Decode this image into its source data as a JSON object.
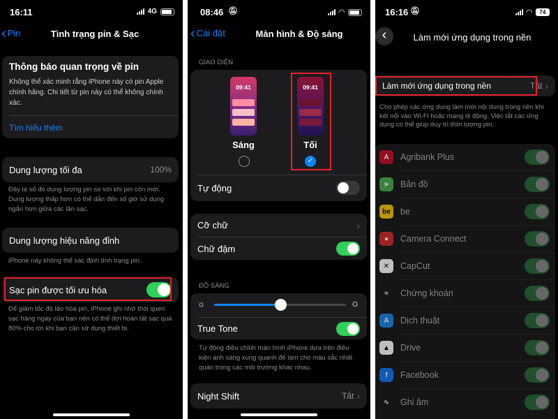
{
  "panel1": {
    "status": {
      "time": "16:11",
      "network": "4G"
    },
    "back_label": "Pin",
    "title": "Tình trạng pin & Sạc",
    "notice": {
      "title": "Thông báo quan trọng về pin",
      "body": "Không thể xác minh rằng iPhone này có pin Apple chính hãng. Chi tiết từ pin này có thể không chính xác.",
      "link": "Tìm hiểu thêm"
    },
    "max_capacity": {
      "label": "Dung lượng tối đa",
      "value": "100%"
    },
    "max_capacity_note": "Đây là số đo dung lượng pin so với khi pin còn mới. Dung lượng thấp hơn có thể dẫn đến số giờ sử dụng ngắn hơn giữa các lần sạc.",
    "peak": {
      "label": "Dung lượng hiệu năng đỉnh"
    },
    "peak_note": "iPhone này không thể xác định tình trạng pin.",
    "optimized": {
      "label": "Sạc pin được tối ưu hóa",
      "enabled": true
    },
    "optimized_note": "Để giảm tốc độ lão hóa pin, iPhone ghi nhớ thói quen sạc hàng ngày của bạn nên có thể đợi hoàn tất sạc quá 80% cho tới khi bạn cần sử dụng thiết bị."
  },
  "panel2": {
    "status": {
      "time": "08:46"
    },
    "back_label": "Cài đặt",
    "title": "Màn hình & Độ sáng",
    "appearance_header": "GIAO DIỆN",
    "light": {
      "label": "Sáng",
      "preview_time": "09:41",
      "selected": false
    },
    "dark": {
      "label": "Tối",
      "preview_time": "09:41",
      "selected": true,
      "check": "✓"
    },
    "automatic": {
      "label": "Tự động",
      "enabled": false
    },
    "text_size": {
      "label": "Cỡ chữ"
    },
    "bold_text": {
      "label": "Chữ đậm",
      "enabled": true
    },
    "brightness_header": "ĐỘ SÁNG",
    "brightness_level": 0.5,
    "true_tone": {
      "label": "True Tone",
      "enabled": true
    },
    "true_tone_note": "Tự động điều chỉnh màn hình iPhone dựa trên điều kiện ánh sáng xung quanh để làm cho màu sắc nhất quán trong các môi trường khác nhau.",
    "night_shift": {
      "label": "Night Shift",
      "value": "Tắt"
    }
  },
  "panel3": {
    "status": {
      "time": "16:16",
      "battery": "74"
    },
    "title": "Làm mới ứng dụng trong nền",
    "bg_refresh": {
      "label": "Làm mới ứng dụng trong nền",
      "value": "Tắt"
    },
    "note": "Cho phép các ứng dụng làm mới nội dung trong nền khi kết nối vào Wi-Fi hoặc mạng di động. Việc tắt các ứng dụng có thể giúp duy trì thời lượng pin.",
    "apps": [
      {
        "name": "Agribank Plus",
        "icon": "agribank-icon",
        "color": "#c8102e",
        "glyph": "A"
      },
      {
        "name": "Bản đồ",
        "icon": "maps-icon",
        "color": "#4caf50",
        "glyph": "➤"
      },
      {
        "name": "be",
        "icon": "be-icon",
        "color": "#f6c800",
        "glyph": "be"
      },
      {
        "name": "Camera Connect",
        "icon": "camera-connect-icon",
        "color": "#d32f2f",
        "glyph": "●"
      },
      {
        "name": "CapCut",
        "icon": "capcut-icon",
        "color": "#ffffff",
        "glyph": "✕"
      },
      {
        "name": "Chứng khoán",
        "icon": "stocks-icon",
        "color": "#1c1c1e",
        "glyph": "≈"
      },
      {
        "name": "Dịch thuật",
        "icon": "translate-icon",
        "color": "#1e88e5",
        "glyph": "A"
      },
      {
        "name": "Drive",
        "icon": "drive-icon",
        "color": "#ffffff",
        "glyph": "▲"
      },
      {
        "name": "Facebook",
        "icon": "facebook-icon",
        "color": "#1877f2",
        "glyph": "f"
      },
      {
        "name": "Ghi âm",
        "icon": "voice-memos-icon",
        "color": "#1c1c1e",
        "glyph": "∿"
      }
    ]
  },
  "colors": {
    "accent": "#0a84ff",
    "toggle_on": "#30d158",
    "highlight": "#e8202a"
  }
}
